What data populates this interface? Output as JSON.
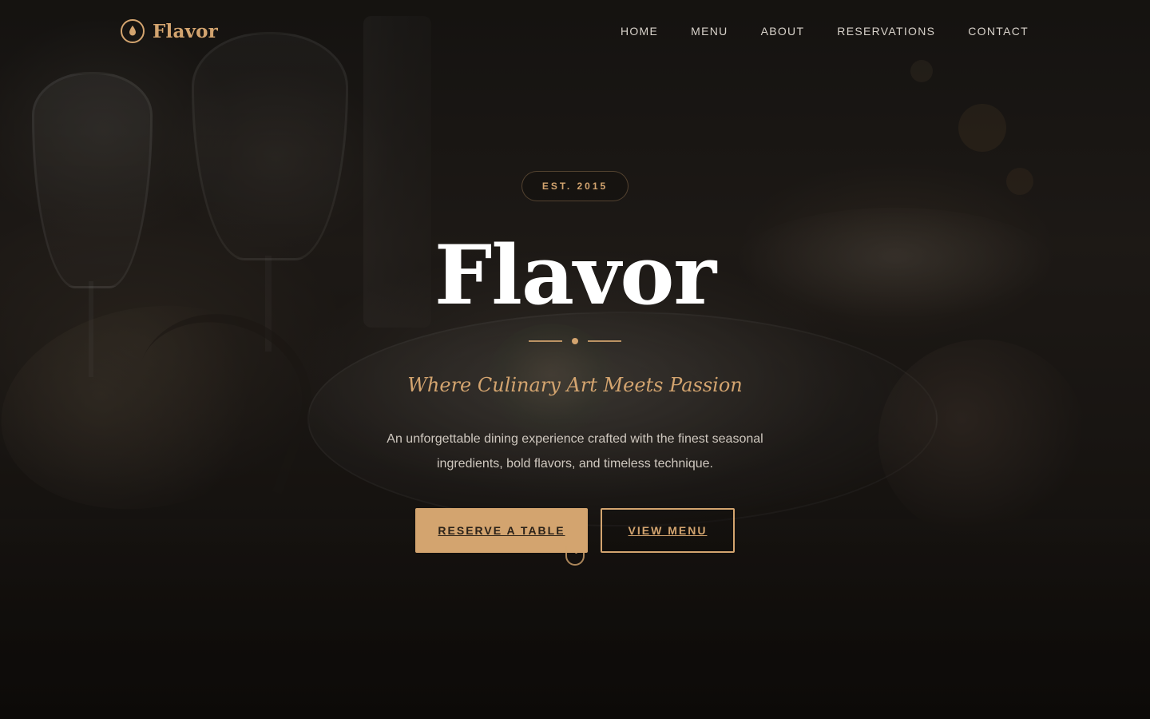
{
  "nav": {
    "brand": "Flavor",
    "brand_icon": "drop-icon",
    "items": [
      {
        "label": "HOME"
      },
      {
        "label": "MENU"
      },
      {
        "label": "ABOUT"
      },
      {
        "label": "RESERVATIONS"
      },
      {
        "label": "CONTACT"
      }
    ]
  },
  "hero": {
    "established": "EST. 2015",
    "title": "Flavor",
    "subtitle": "Where Culinary Art Meets Passion",
    "description": "An unforgettable dining experience crafted with the finest seasonal ingredients, bold flavors, and timeless technique.",
    "buttons": {
      "primary": "RESERVE A TABLE",
      "secondary": "VIEW MENU"
    },
    "scroll_icon": "scroll-indicator-icon"
  },
  "colors": {
    "accent": "#d3a46f",
    "text_light": "#ffffff",
    "nav_text": "#d8d2ca",
    "body_text": "#cfc8bf",
    "overlay": "#000000"
  }
}
